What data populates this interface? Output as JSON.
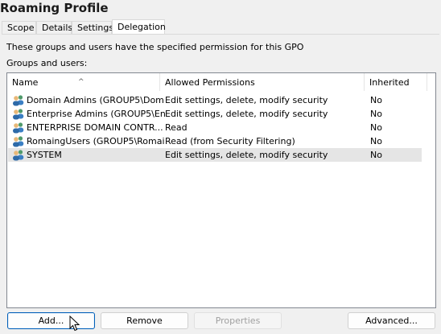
{
  "window": {
    "title": "Roaming Profile"
  },
  "tabs": [
    {
      "label": "Scope"
    },
    {
      "label": "Details"
    },
    {
      "label": "Settings"
    },
    {
      "label": "Delegation",
      "active": true
    }
  ],
  "panel": {
    "info_text": "These groups and users have the specified permission for this GPO",
    "groups_label": "Groups and users:"
  },
  "list": {
    "columns": [
      "Name",
      "Allowed Permissions",
      "Inherited"
    ],
    "sort_indicator": "^",
    "rows": [
      {
        "name": "Domain Admins (GROUP5\\Dom...",
        "permissions": "Edit settings, delete, modify security",
        "inherited": "No",
        "icon": "group-icon"
      },
      {
        "name": "Enterprise Admins (GROUP5\\Ent...",
        "permissions": "Edit settings, delete, modify security",
        "inherited": "No",
        "icon": "group-icon"
      },
      {
        "name": "ENTERPRISE DOMAIN CONTR...",
        "permissions": "Read",
        "inherited": "No",
        "icon": "group-icon"
      },
      {
        "name": "RomaingUsers (GROUP5\\Romai...",
        "permissions": "Read (from Security Filtering)",
        "inherited": "No",
        "icon": "group-icon"
      },
      {
        "name": "SYSTEM",
        "permissions": "Edit settings, delete, modify security",
        "inherited": "No",
        "icon": "group-icon",
        "selected": true
      }
    ]
  },
  "buttons": {
    "add": "Add...",
    "remove": "Remove",
    "properties": "Properties",
    "advanced": "Advanced..."
  },
  "colors": {
    "accent": "#005fb8",
    "selected_row": "#e5e5e5"
  }
}
